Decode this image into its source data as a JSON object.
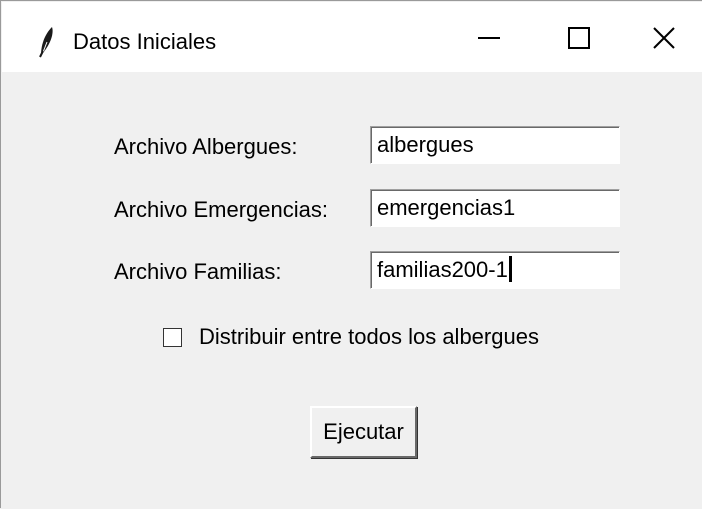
{
  "window": {
    "title": "Datos Iniciales",
    "icon": "tk-feather-icon"
  },
  "titlebar_buttons": {
    "minimize": "minimize-icon",
    "maximize": "maximize-icon",
    "close": "close-icon"
  },
  "form": {
    "fields": [
      {
        "label": "Archivo Albergues:",
        "value": "albergues"
      },
      {
        "label": "Archivo Emergencias:",
        "value": "emergencias1"
      },
      {
        "label": "Archivo Familias:",
        "value": "familias200-1"
      }
    ],
    "checkbox": {
      "label": "Distribuir entre todos los albergues",
      "checked": false
    },
    "run_button": "Ejecutar"
  }
}
